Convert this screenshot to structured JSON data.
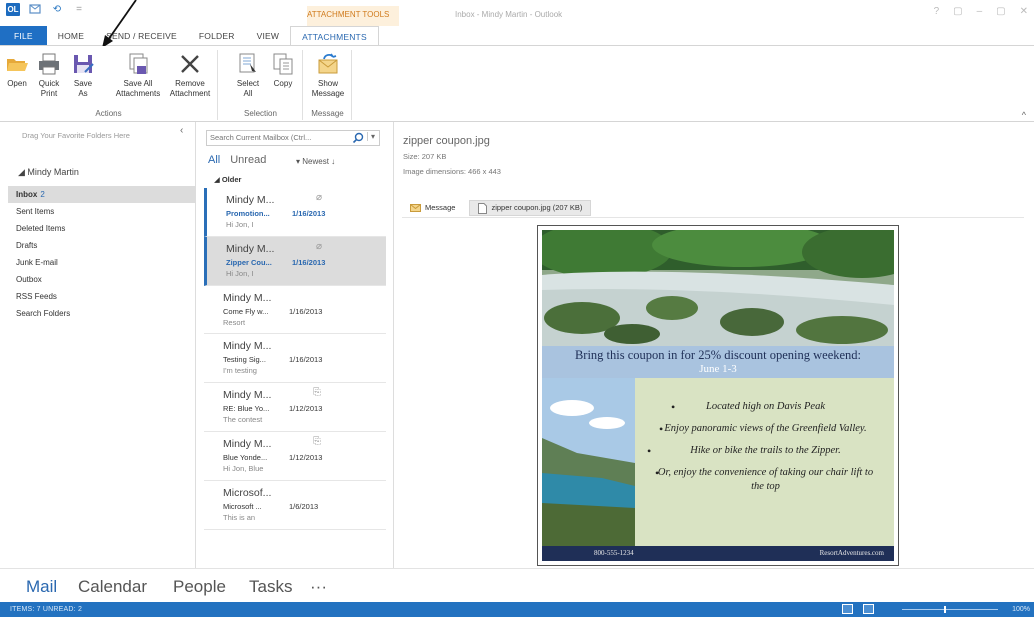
{
  "window": {
    "title": "Inbox - Mindy Martin - Outlook",
    "context_label": "ATTACHMENT TOOLS",
    "controls": [
      "?",
      "▢",
      "–",
      "▢",
      "✕"
    ]
  },
  "qat": [
    "OL",
    "⟲"
  ],
  "tabs": [
    "FILE",
    "HOME",
    "SEND / RECEIVE",
    "FOLDER",
    "VIEW",
    "ATTACHMENTS"
  ],
  "ribbon": {
    "groups": {
      "actions": {
        "label": "Actions",
        "buttons": [
          {
            "l1": "Open",
            "l2": ""
          },
          {
            "l1": "Quick",
            "l2": "Print"
          },
          {
            "l1": "Save",
            "l2": "As"
          },
          {
            "l1": "Save All",
            "l2": "Attachments"
          },
          {
            "l1": "Remove",
            "l2": "Attachment"
          }
        ]
      },
      "selection": {
        "label": "Selection",
        "buttons": [
          {
            "l1": "Select",
            "l2": "All"
          },
          {
            "l1": "Copy",
            "l2": ""
          }
        ]
      },
      "message": {
        "label": "Message",
        "buttons": [
          {
            "l1": "Show",
            "l2": "Message"
          }
        ]
      }
    },
    "collapse": "^"
  },
  "folders": {
    "drag_hint": "Drag Your Favorite Folders Here",
    "collapse": "‹",
    "account": "◢ Mindy Martin",
    "items": [
      {
        "name": "Inbox",
        "count": "2"
      },
      {
        "name": "Sent Items",
        "count": ""
      },
      {
        "name": "Deleted Items",
        "count": ""
      },
      {
        "name": "Drafts",
        "count": ""
      },
      {
        "name": "Junk E-mail",
        "count": ""
      },
      {
        "name": "Outbox",
        "count": ""
      },
      {
        "name": "RSS Feeds",
        "count": ""
      },
      {
        "name": "Search Folders",
        "count": ""
      }
    ]
  },
  "msglist": {
    "search_placeholder": "Search Current Mailbox (Ctrl...",
    "filter_all": "All",
    "filter_unread": "Unread",
    "sort": "Newest ↓",
    "group": "◢ Older",
    "items": [
      {
        "from": "Mindy M...",
        "subject": "Promotion...",
        "date": "1/16/2013",
        "preview": "Hi Jon, I",
        "unread": true,
        "icon": "paperclip"
      },
      {
        "from": "Mindy M...",
        "subject": "Zipper Cou...",
        "date": "1/16/2013",
        "preview": "Hi Jon, I",
        "unread": true,
        "icon": "paperclip"
      },
      {
        "from": "Mindy M...",
        "subject": "Come Fly w...",
        "date": "1/16/2013",
        "preview": "Resort",
        "unread": false,
        "icon": ""
      },
      {
        "from": "Mindy M...",
        "subject": "Testing Sig...",
        "date": "1/16/2013",
        "preview": "I'm testing",
        "unread": false,
        "icon": ""
      },
      {
        "from": "Mindy M...",
        "subject": "RE: Blue Yo...",
        "date": "1/12/2013",
        "preview": "The contest",
        "unread": false,
        "icon": "reply"
      },
      {
        "from": "Mindy M...",
        "subject": "Blue Yonde...",
        "date": "1/12/2013",
        "preview": "Hi Jon, Blue",
        "unread": false,
        "icon": "reply"
      },
      {
        "from": "Microsof...",
        "subject": "Microsoft ...",
        "date": "1/6/2013",
        "preview": "This is an",
        "unread": false,
        "icon": ""
      }
    ]
  },
  "reading": {
    "attachment_name": "zipper coupon.jpg",
    "size_line": "Size:  207 KB",
    "dimensions_line": "Image dimensions:  466 x 443",
    "tab_message": "Message",
    "tab_file": "zipper coupon.jpg (207 KB)"
  },
  "coupon": {
    "headline": "Bring this coupon in for 25% discount opening weekend:",
    "date": "June 1-3",
    "bullets": [
      "Located high on Davis Peak",
      "Enjoy panoramic views of the Greenfield Valley.",
      "Hike or bike the trails to the Zipper.",
      "Or, enjoy the convenience of taking our chair lift to the top"
    ],
    "phone": "800-555-1234",
    "website": "ResortAdventures.com"
  },
  "nav": [
    "Mail",
    "Calendar",
    "People",
    "Tasks",
    "···"
  ],
  "status": {
    "left": "ITEMS: 7    UNREAD: 2",
    "zoom": "100%"
  }
}
